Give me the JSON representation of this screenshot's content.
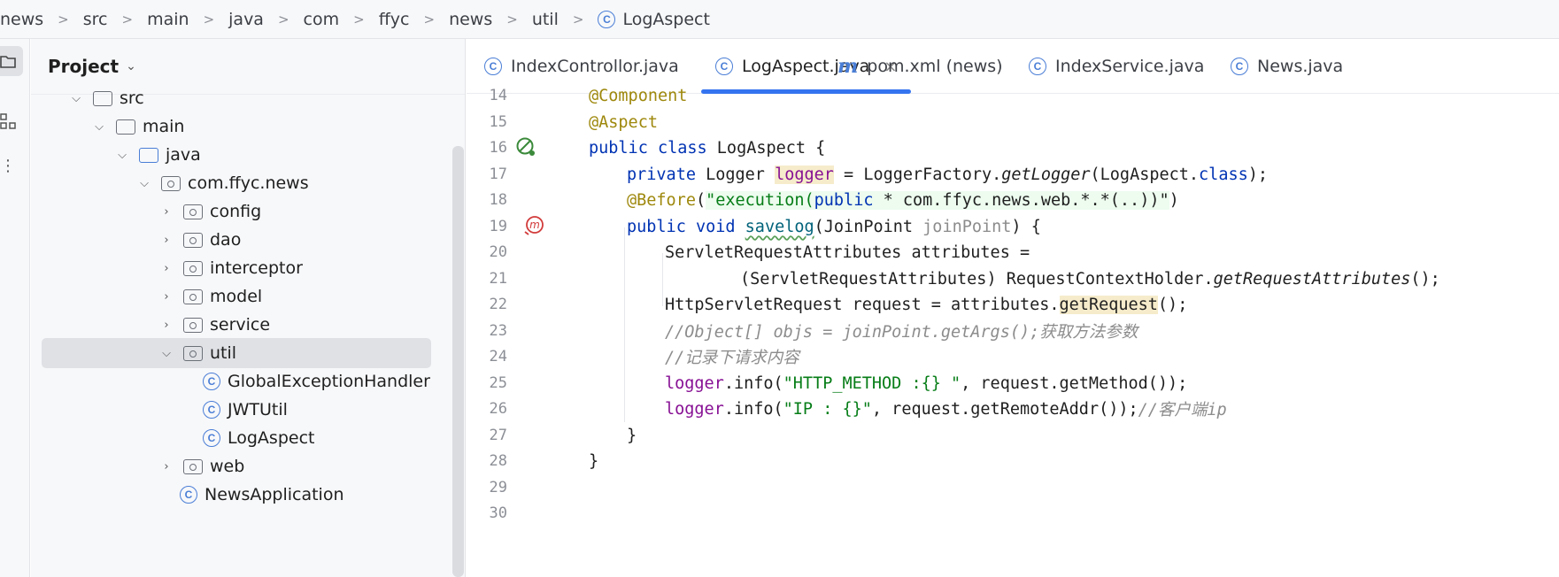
{
  "breadcrumb": {
    "segments": [
      "news",
      "src",
      "main",
      "java",
      "com",
      "ffyc",
      "news",
      "util"
    ],
    "current": "LogAspect",
    "class_icon_letter": "C"
  },
  "project_panel": {
    "title": "Project",
    "tree": [
      {
        "label": "src",
        "kind": "folder"
      },
      {
        "label": "main",
        "kind": "folder"
      },
      {
        "label": "java",
        "kind": "source-folder"
      },
      {
        "label": "com.ffyc.news",
        "kind": "package"
      },
      {
        "label": "config",
        "kind": "package"
      },
      {
        "label": "dao",
        "kind": "package"
      },
      {
        "label": "interceptor",
        "kind": "package"
      },
      {
        "label": "model",
        "kind": "package"
      },
      {
        "label": "service",
        "kind": "package"
      },
      {
        "label": "util",
        "kind": "package"
      },
      {
        "label": "GlobalExceptionHandler",
        "kind": "class"
      },
      {
        "label": "JWTUtil",
        "kind": "class"
      },
      {
        "label": "LogAspect",
        "kind": "class"
      },
      {
        "label": "web",
        "kind": "package"
      },
      {
        "label": "NewsApplication",
        "kind": "class"
      }
    ]
  },
  "tabs": [
    {
      "label": "IndexControllor.java",
      "icon": "class-icon",
      "active": false
    },
    {
      "label": "LogAspect.java",
      "icon": "class-icon",
      "active": true,
      "close": "×"
    },
    {
      "label": "pom.xml (news)",
      "icon": "maven-icon",
      "icon_glyph": "m",
      "active": false
    },
    {
      "label": "IndexService.java",
      "icon": "class-icon",
      "active": false
    },
    {
      "label": "News.java",
      "icon": "class-icon",
      "active": false
    }
  ],
  "editor": {
    "line_numbers": [
      "14",
      "15",
      "16",
      "17",
      "18",
      "19",
      "20",
      "21",
      "22",
      "23",
      "24",
      "25",
      "26",
      "27",
      "28",
      "29",
      "30"
    ],
    "code": {
      "l14": "@Component",
      "l15": "@Aspect",
      "l16": [
        "public class",
        " LogAspect {"
      ],
      "l17": [
        "private",
        " Logger ",
        "logger",
        " = LoggerFactory.",
        "getLogger",
        "(LogAspect.",
        "class",
        ");"
      ],
      "l18": [
        "@Before",
        "(",
        "\"execution(",
        "public",
        " * com.ffyc.news.web.*.*(..))\"",
        ")"
      ],
      "l19": [
        "public void",
        " ",
        "savelog",
        "(JoinPoint ",
        "joinPoint",
        ") {"
      ],
      "l20": "ServletRequestAttributes attributes =",
      "l21": [
        "(ServletRequestAttributes) RequestContextHolder.",
        "getRequestAttributes",
        "();"
      ],
      "l22": [
        "HttpServletRequest request = attributes.",
        "getRequest",
        "();"
      ],
      "l23": "//Object[] objs = joinPoint.getArgs();获取方法参数",
      "l24": "//记录下请求内容",
      "l25": [
        "logger",
        ".info(",
        "\"HTTP_METHOD :{} \"",
        ", request.getMethod());"
      ],
      "l26": [
        "logger",
        ".info(",
        "\"IP : {}\"",
        ", request.getRemoteAddr());",
        "//客户端ip"
      ],
      "l27": "}",
      "l28": "}"
    },
    "colors": {
      "keyword": "#0033b3",
      "annotation": "#9e880d",
      "string": "#067d17",
      "field": "#871094",
      "comment": "#8c8c8c",
      "accent": "#3574f0"
    }
  }
}
